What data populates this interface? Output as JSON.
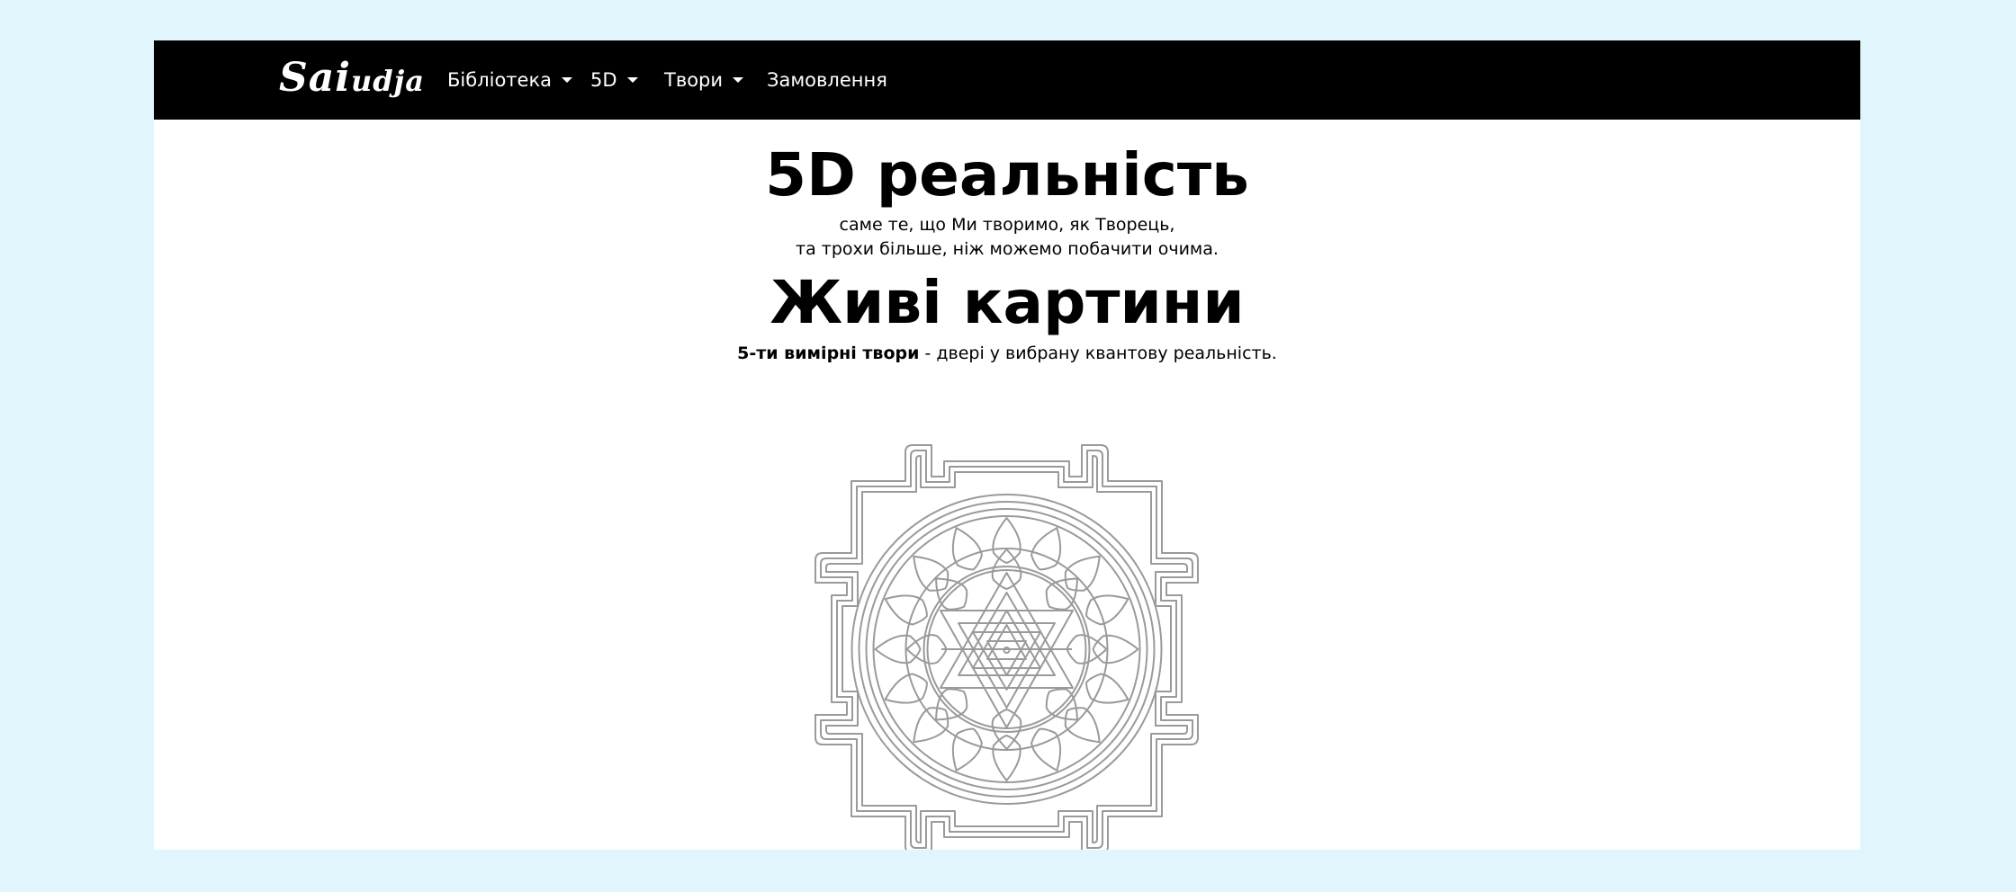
{
  "navbar": {
    "brand_big": "Sai",
    "brand_small": "udja",
    "items": [
      {
        "label": "Бібліотека",
        "dropdown": true
      },
      {
        "label": "5D",
        "dropdown": true
      },
      {
        "label": "Твори",
        "dropdown": true
      },
      {
        "label": "Замовлення",
        "dropdown": false
      }
    ]
  },
  "hero": {
    "title": "5D реальність",
    "subtitle_line1": "саме те, що Ми творимо, як Творець,",
    "subtitle_line2": "та трохи більше, ніж можемо побачити очима.",
    "title2": "Живі картини",
    "tagline_bold": "5-ти вимірні твори",
    "tagline_rest": " - двері у вибрану квантову реальність."
  },
  "image": {
    "icon": "sri-yantra-mandala",
    "stroke_color": "#9a9a9a"
  },
  "colors": {
    "background": "#e1f6fc",
    "navbar": "#000000",
    "page": "#ffffff",
    "text": "#000000"
  }
}
